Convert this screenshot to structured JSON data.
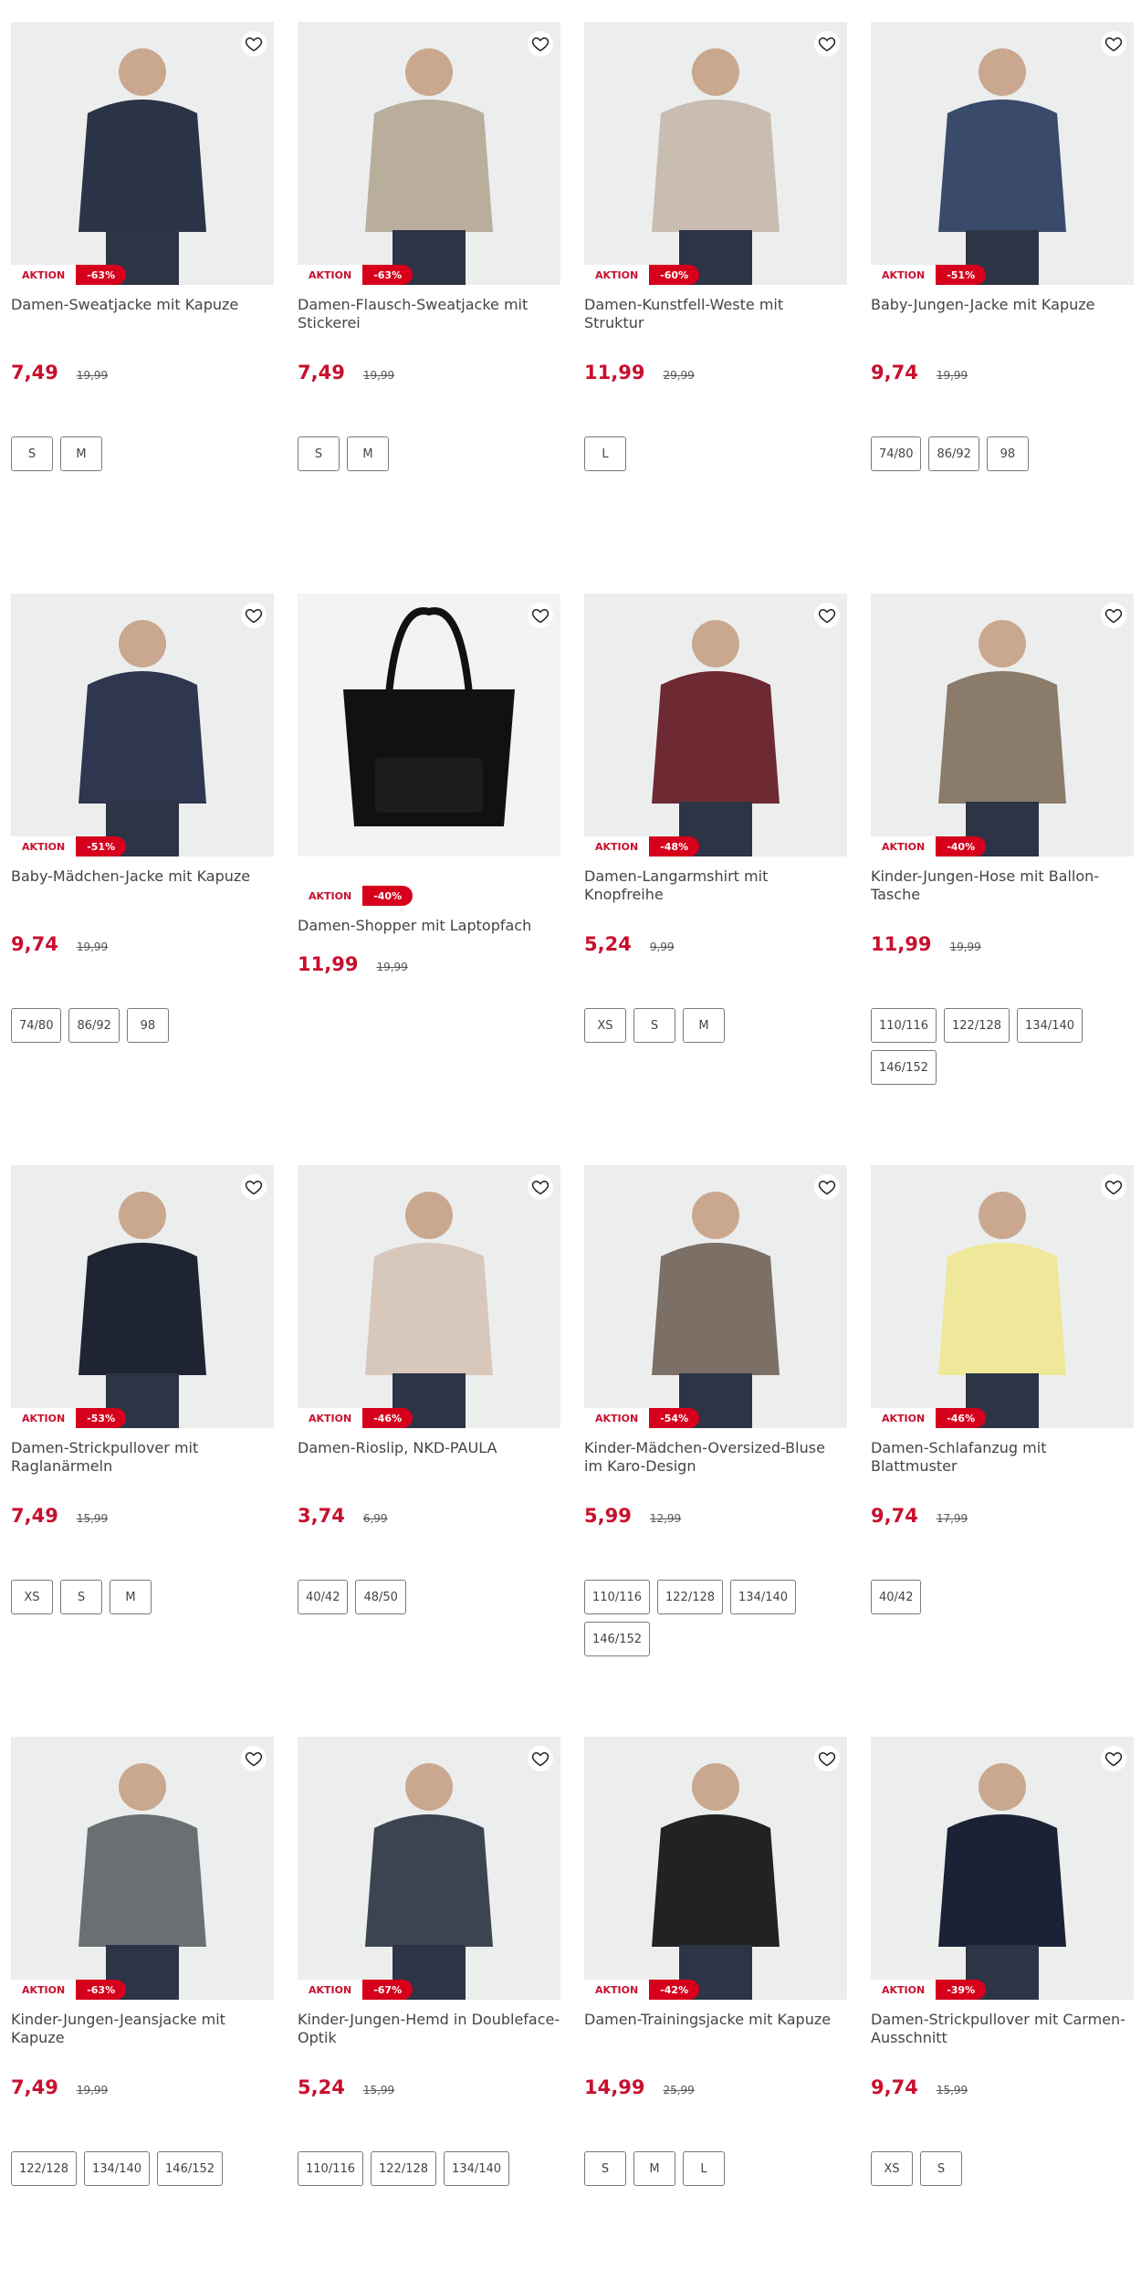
{
  "labels": {
    "aktion": "AKTION"
  },
  "colors": {
    "accent": "#c8102e",
    "badge": "#d6001c"
  },
  "products": [
    {
      "name": "Damen-Sweatjacke mit Kapuze",
      "price": "7,49",
      "old_price": "19,99",
      "discount": "-63%",
      "sizes": [
        "S",
        "M"
      ],
      "image_tone": "#2b3446"
    },
    {
      "name": "Damen-Flausch-Sweatjacke mit Stickerei",
      "price": "7,49",
      "old_price": "19,99",
      "discount": "-63%",
      "sizes": [
        "S",
        "M"
      ],
      "image_tone": "#b9ad9c"
    },
    {
      "name": "Damen-Kunstfell-Weste mit Struktur",
      "price": "11,99",
      "old_price": "29,99",
      "discount": "-60%",
      "sizes": [
        "L"
      ],
      "image_tone": "#c9bcb0"
    },
    {
      "name": "Baby-Jungen-Jacke mit Kapuze",
      "price": "9,74",
      "old_price": "19,99",
      "discount": "-51%",
      "sizes": [
        "74/80",
        "86/92",
        "98"
      ],
      "image_tone": "#3a4a6b"
    },
    {
      "name": "Baby-Mädchen-Jacke mit Kapuze",
      "price": "9,74",
      "old_price": "19,99",
      "discount": "-51%",
      "sizes": [
        "74/80",
        "86/92",
        "98"
      ],
      "image_tone": "#2f3650"
    },
    {
      "name": "Damen-Shopper mit Laptopfach",
      "price": "11,99",
      "old_price": "19,99",
      "discount": "-40%",
      "sizes": [],
      "image_tone": "#111111"
    },
    {
      "name": "Damen-Langarmshirt mit Knopfreihe",
      "price": "5,24",
      "old_price": "9,99",
      "discount": "-48%",
      "sizes": [
        "XS",
        "S",
        "M"
      ],
      "image_tone": "#6e2a33"
    },
    {
      "name": "Kinder-Jungen-Hose mit Ballon-Tasche",
      "price": "11,99",
      "old_price": "19,99",
      "discount": "-40%",
      "sizes": [
        "110/116",
        "122/128",
        "134/140",
        "146/152"
      ],
      "image_tone": "#8a7b6a"
    },
    {
      "name": "Damen-Strickpullover mit Raglanärmeln",
      "price": "7,49",
      "old_price": "15,99",
      "discount": "-53%",
      "sizes": [
        "XS",
        "S",
        "M"
      ],
      "image_tone": "#1f2433"
    },
    {
      "name": "Damen-Rioslip, NKD-PAULA",
      "price": "3,74",
      "old_price": "6,99",
      "discount": "-46%",
      "sizes": [
        "40/42",
        "48/50"
      ],
      "image_tone": "#d8c7bb"
    },
    {
      "name": "Kinder-Mädchen-Oversized-Bluse im Karo-Design",
      "price": "5,99",
      "old_price": "12,99",
      "discount": "-54%",
      "sizes": [
        "110/116",
        "122/128",
        "134/140",
        "146/152"
      ],
      "image_tone": "#7c6f66"
    },
    {
      "name": "Damen-Schlafanzug mit Blattmuster",
      "price": "9,74",
      "old_price": "17,99",
      "discount": "-46%",
      "sizes": [
        "40/42"
      ],
      "image_tone": "#efe79a"
    },
    {
      "name": "Kinder-Jungen-Jeansjacke mit Kapuze",
      "price": "7,49",
      "old_price": "19,99",
      "discount": "-63%",
      "sizes": [
        "122/128",
        "134/140",
        "146/152"
      ],
      "image_tone": "#6a6f74"
    },
    {
      "name": "Kinder-Jungen-Hemd in Doubleface-Optik",
      "price": "5,24",
      "old_price": "15,99",
      "discount": "-67%",
      "sizes": [
        "110/116",
        "122/128",
        "134/140"
      ],
      "image_tone": "#3c4452"
    },
    {
      "name": "Damen-Trainingsjacke mit Kapuze",
      "price": "14,99",
      "old_price": "25,99",
      "discount": "-42%",
      "sizes": [
        "S",
        "M",
        "L"
      ],
      "image_tone": "#222222"
    },
    {
      "name": "Damen-Strickpullover mit Carmen-Ausschnitt",
      "price": "9,74",
      "old_price": "15,99",
      "discount": "-39%",
      "sizes": [
        "XS",
        "S"
      ],
      "image_tone": "#1c2235"
    }
  ]
}
